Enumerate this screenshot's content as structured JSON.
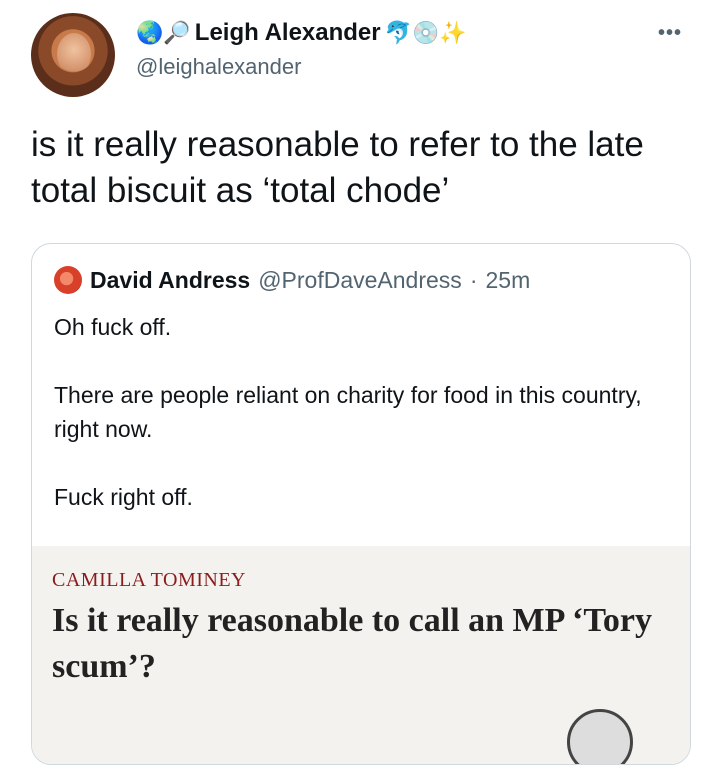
{
  "author": {
    "display_name": "Leigh Alexander",
    "prefix_emoji": "🌏🔎",
    "suffix_emoji": "🐬💿✨",
    "handle": "@leighalexander"
  },
  "menu": {
    "more_label": "•••"
  },
  "tweet": {
    "text": "is it really reasonable to refer to the late total biscuit as ‘total chode’"
  },
  "quoted_tweet": {
    "author_name": "David Andress",
    "handle": "@ProfDaveAndress",
    "separator": "·",
    "time": "25m",
    "paragraphs": [
      "Oh fuck off.",
      "There are people reliant on charity for food in this country, right now.",
      "Fuck right off."
    ],
    "link_card": {
      "author": "CAMILLA TOMINEY",
      "title": "Is it really reasonable to call an MP ‘Tory scum’?"
    }
  }
}
